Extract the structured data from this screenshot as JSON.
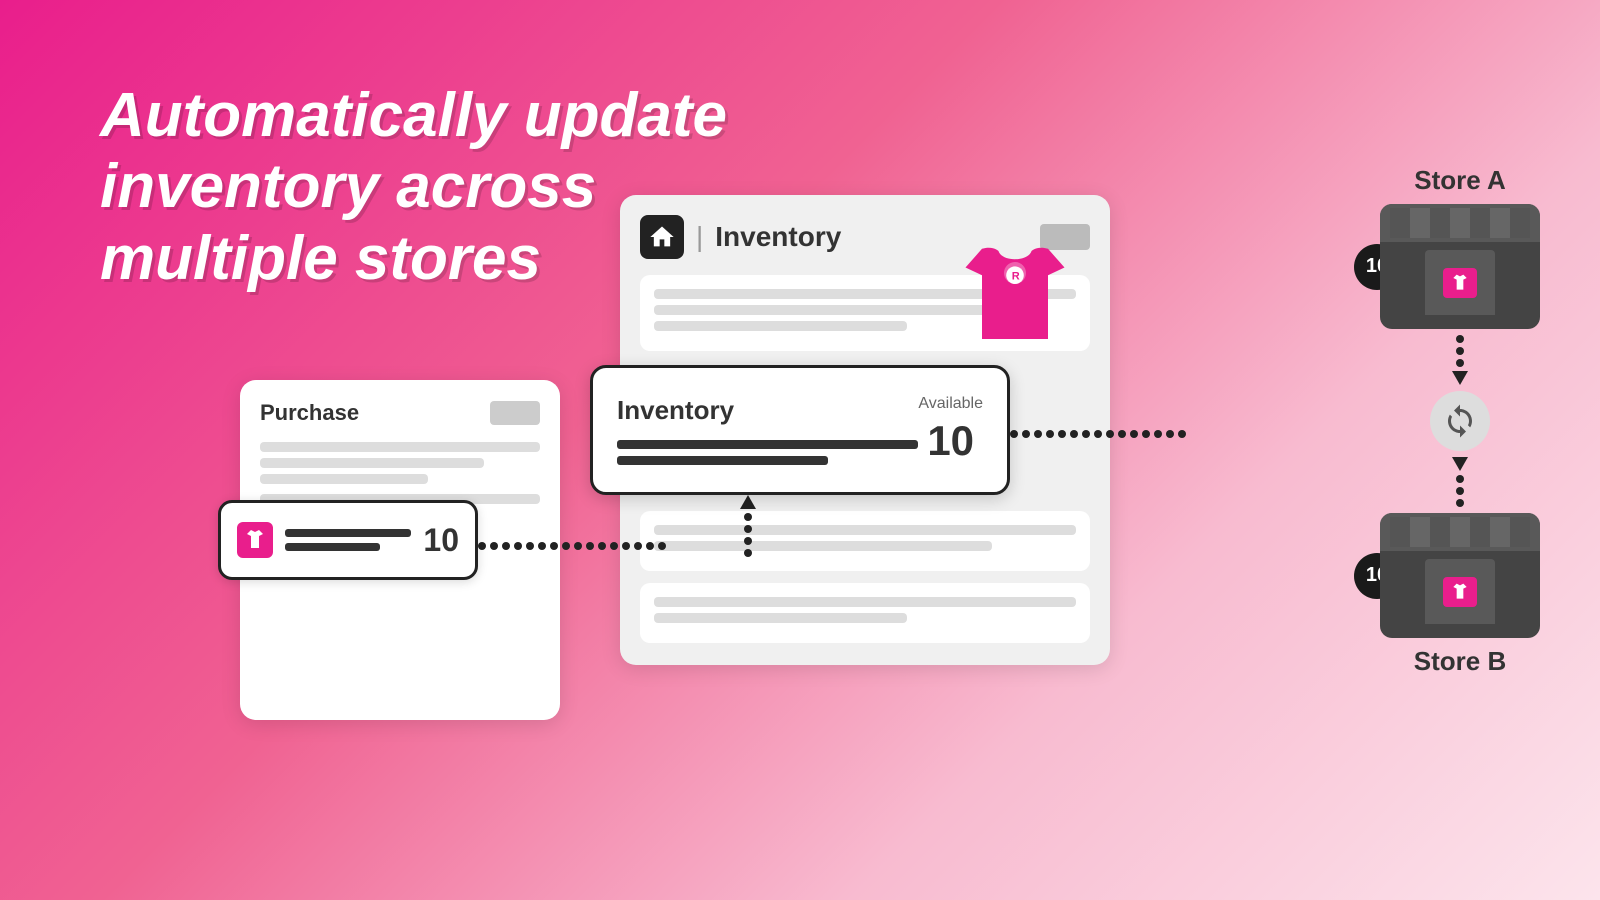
{
  "headline": {
    "line1": "Automatically update inventory across",
    "line2": "multiple stores"
  },
  "purchase_card": {
    "title": "Purchase",
    "quantity": "10"
  },
  "inventory_card": {
    "title": "Inventory",
    "available_label": "Available",
    "available_number": "10"
  },
  "stores": {
    "store_a": {
      "label": "Store A",
      "count": "10"
    },
    "store_b": {
      "label": "Store B",
      "count": "10"
    }
  },
  "icons": {
    "sync": "🔄",
    "shirt_unicode": "👕"
  }
}
